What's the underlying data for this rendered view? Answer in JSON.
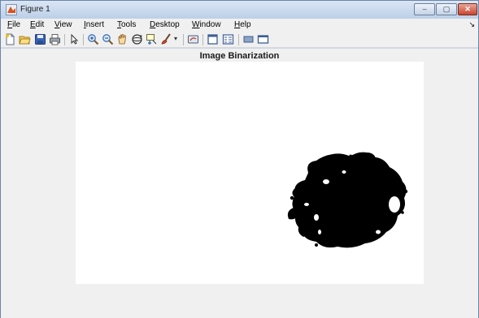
{
  "window": {
    "title": "Figure 1",
    "controls": {
      "minimize": "–",
      "maximize": "▢",
      "close": "✕"
    }
  },
  "menubar": {
    "items": [
      {
        "first": "F",
        "rest": "ile"
      },
      {
        "first": "E",
        "rest": "dit"
      },
      {
        "first": "V",
        "rest": "iew"
      },
      {
        "first": "I",
        "rest": "nsert"
      },
      {
        "first": "T",
        "rest": "ools"
      },
      {
        "first": "D",
        "rest": "esktop"
      },
      {
        "first": "W",
        "rest": "indow"
      },
      {
        "first": "H",
        "rest": "elp"
      }
    ],
    "overflow_arrow": "↘"
  },
  "toolbar": {
    "buttons": [
      "new-figure-icon",
      "open-file-icon",
      "save-icon",
      "print-icon",
      "pointer-icon",
      "zoom-in-icon",
      "zoom-out-icon",
      "pan-icon",
      "rotate-3d-icon",
      "data-cursor-icon",
      "brush-icon",
      "brush-dropdown-icon",
      "link-plot-icon",
      "colorbar-icon",
      "legend-icon",
      "hide-plot-tools-icon",
      "show-plot-tools-icon"
    ]
  },
  "figure": {
    "title": "Image Binarization",
    "colors": {
      "foreground": "#000000",
      "background": "#ffffff",
      "figure_bg": "#f0f0f0"
    }
  }
}
